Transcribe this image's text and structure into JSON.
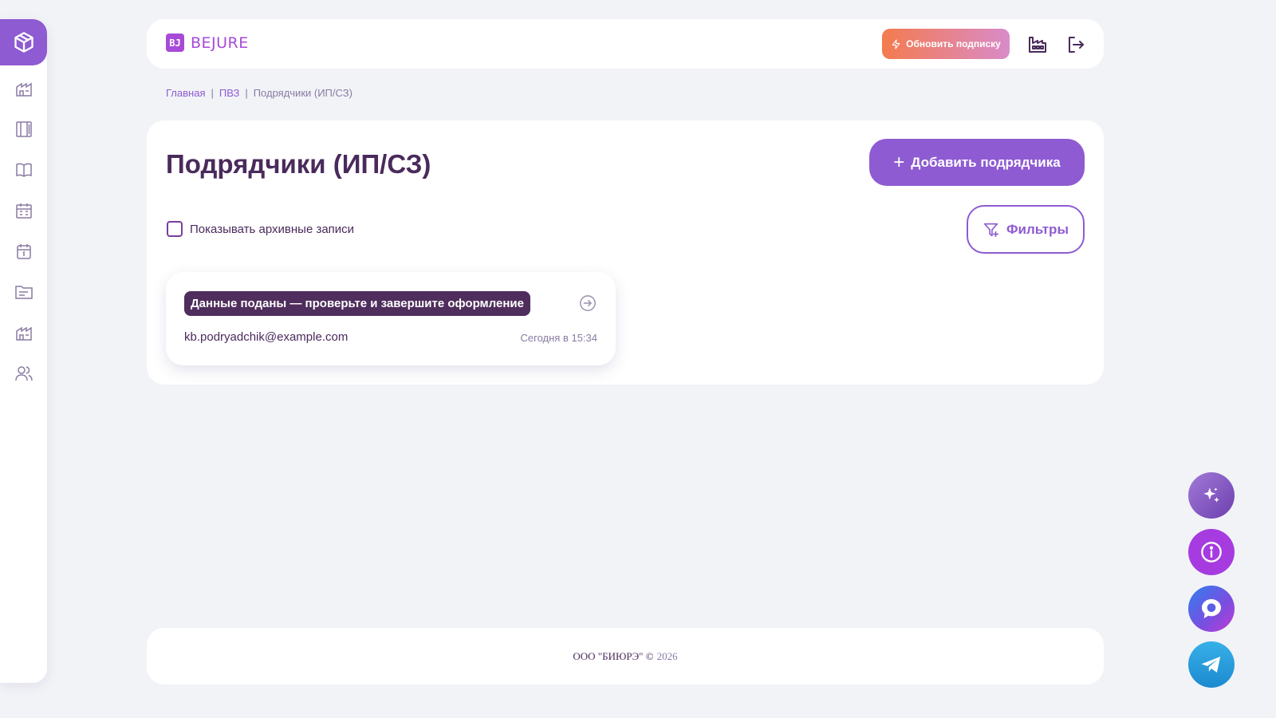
{
  "sidebar": {
    "items": [
      {
        "name": "warehouse-icon"
      },
      {
        "name": "columns-icon"
      },
      {
        "name": "book-icon"
      },
      {
        "name": "calendar-grid-icon"
      },
      {
        "name": "calendar-day-icon"
      },
      {
        "name": "folder-icon"
      },
      {
        "name": "building-icon"
      },
      {
        "name": "users-icon"
      }
    ],
    "accent": "#8e5bd2"
  },
  "header": {
    "brand_mark": "BJ",
    "brand_name": "BEJURE",
    "upgrade_label": "Обновить подписку"
  },
  "breadcrumb": {
    "items": [
      "Главная",
      "ПВЗ",
      "Подрядчики (ИП/СЗ)"
    ],
    "separator": "|"
  },
  "main": {
    "title": "Подрядчики (ИП/СЗ)",
    "add_button_label": "Добавить подрядчика",
    "archive_checkbox_label": "Показывать архивные записи",
    "archive_checked": false,
    "filter_button_label": "Фильтры"
  },
  "cards": [
    {
      "status": "Данные поданы — проверьте и завершите оформление",
      "email": "kb.podryadchik@example.com",
      "date": "Сегодня в 15:34"
    }
  ],
  "footer": {
    "company": "ООО \"БИЮРЭ\" ©",
    "year": "2026"
  },
  "colors": {
    "accent": "#8e5bd2",
    "text_dark": "#4a2a5c",
    "badge_bg": "#4f2d5c",
    "upgrade_gradient_start": "#f47b4e",
    "upgrade_gradient_end": "#d98bc9"
  }
}
